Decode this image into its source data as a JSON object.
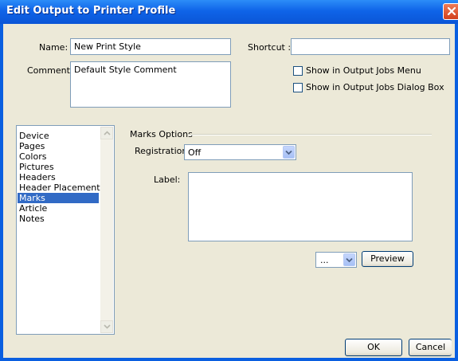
{
  "window": {
    "title": "Edit Output to Printer Profile"
  },
  "form": {
    "name_label": "Name:",
    "name_value": "New Print Style",
    "comment_label": "Comment:",
    "comment_value": "Default Style Comment",
    "shortcut_label": "Shortcut :",
    "shortcut_value": "",
    "show_in_menu_label": "Show in Output Jobs Menu",
    "show_in_menu_checked": false,
    "show_in_dialog_label": "Show in Output Jobs Dialog Box",
    "show_in_dialog_checked": false
  },
  "categories": {
    "items": [
      "Device",
      "Pages",
      "Colors",
      "Pictures",
      "Headers",
      "Header Placement",
      "Marks",
      "Article",
      "Notes"
    ],
    "selected": "Marks"
  },
  "marks": {
    "section_title": "Marks Options",
    "registration_label": "Registration:",
    "registration_value": "Off",
    "label_label": "Label:",
    "label_value": "",
    "preview_select_value": "...",
    "preview_button": "Preview"
  },
  "buttons": {
    "ok": "OK",
    "cancel": "Cancel"
  },
  "icons": {
    "close": "close-icon",
    "scroll_up": "scroll-up-arrow-icon",
    "scroll_down": "scroll-down-arrow-icon",
    "dropdown": "chevron-down-icon"
  }
}
